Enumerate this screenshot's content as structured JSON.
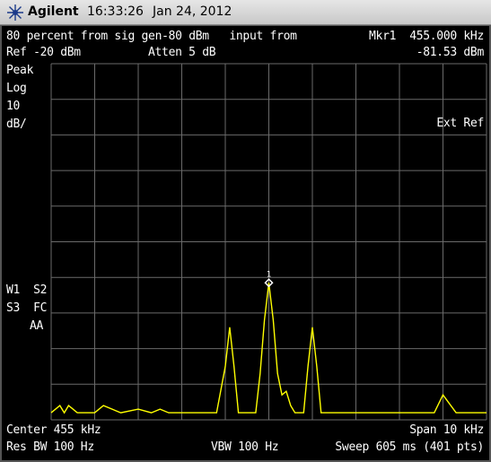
{
  "header": {
    "brand": "Agilent",
    "time": "16:33:26",
    "date": "Jan 24, 2012",
    "logo_icon": "agilent-spark-icon"
  },
  "annotations": {
    "title_line": "80 percent from sig gen-80 dBm   input from",
    "ref_level": "Ref -20 dBm",
    "atten": "Atten 5 dB",
    "marker_label": "Mkr1  455.000 kHz",
    "marker_value": "-81.53 dBm",
    "detector": "Peak",
    "scale_type": "Log",
    "scale_value": "10",
    "scale_unit": "dB/",
    "ext_ref": "Ext Ref",
    "trace_w1": "W1  S2",
    "trace_s3": "S3  FC",
    "trace_aa": "AA",
    "center": "Center 455 kHz",
    "span": "Span 10 kHz",
    "res_bw": "Res BW 100 Hz",
    "vbw": "VBW 100 Hz",
    "sweep": "Sweep 605 ms (401 pts)",
    "marker_number": "1"
  },
  "colors": {
    "trace": "#ffff00",
    "grid": "#6a6a6a",
    "text": "#ffffff",
    "background": "#000000"
  },
  "chart_data": {
    "type": "line",
    "x_unit": "kHz",
    "y_unit": "dBm",
    "xlim": [
      450,
      460
    ],
    "ylim": [
      -120,
      -20
    ],
    "grid": true,
    "series": [
      {
        "x": [
          450.0,
          450.2,
          450.3,
          450.4,
          450.5,
          450.6,
          450.7,
          451.0,
          451.2,
          451.6,
          452.0,
          452.3,
          452.5,
          452.7,
          453.0,
          453.5,
          453.8,
          454.0,
          454.1,
          454.2,
          454.3,
          454.4,
          454.5,
          454.7,
          454.8,
          454.9,
          455.0,
          455.1,
          455.2,
          455.3,
          455.4,
          455.5,
          455.6,
          455.8,
          455.9,
          456.0,
          456.1,
          456.2,
          456.3,
          456.5,
          457.0,
          458.0,
          458.5,
          458.8,
          459.0,
          459.3,
          459.6,
          460.0
        ],
        "y": [
          -118,
          -116,
          -118,
          -116,
          -117,
          -118,
          -118,
          -118,
          -116,
          -118,
          -117,
          -118,
          -117,
          -118,
          -118,
          -118,
          -118,
          -105,
          -94,
          -105,
          -118,
          -118,
          -118,
          -118,
          -107,
          -92,
          -81.5,
          -92,
          -107,
          -113,
          -112,
          -116,
          -118,
          -118,
          -105,
          -94,
          -105,
          -118,
          -118,
          -118,
          -118,
          -118,
          -118,
          -118,
          -113,
          -118,
          -118,
          -118
        ]
      }
    ],
    "marker": {
      "x": 455.0,
      "y": -81.53,
      "label": "1"
    }
  }
}
